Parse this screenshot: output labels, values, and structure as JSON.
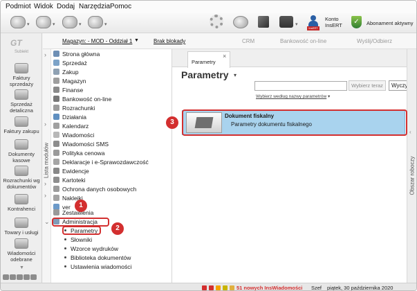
{
  "menu": [
    "Podmiot",
    "Widok",
    "Dodaj",
    "Narzędzia",
    "Pomoc"
  ],
  "toolbar": {
    "konto_line1": "Konto",
    "konto_line2": "InsERT",
    "abonament": "Abonament aktywny"
  },
  "subjekt": {
    "label": "Subiekt"
  },
  "left_nav": [
    {
      "label_1": "Faktury",
      "label_2": "sprzedaży"
    },
    {
      "label_1": "Sprzedaż",
      "label_2": "detaliczna"
    },
    {
      "label_1": "Faktury zakupu",
      "label_2": ""
    },
    {
      "label_1": "Dokumenty",
      "label_2": "kasowe"
    },
    {
      "label_1": "Rozrachunki wg",
      "label_2": "dokumentów"
    },
    {
      "label_1": "Kontrahenci",
      "label_2": ""
    },
    {
      "label_1": "Towary i usługi",
      "label_2": ""
    },
    {
      "label_1": "Wiadomości",
      "label_2": "odebrane"
    }
  ],
  "subbar": {
    "magazyn": "Magazyn: - MOD - Oddział 1",
    "blokady": "Brak blokady",
    "crm": "CRM",
    "bankowosc": "Bankowość on-line",
    "wyslij": "Wyślij/Odbierz"
  },
  "modules_label": "Lista modułów",
  "modules": [
    "Strona główna",
    "Sprzedaż",
    "Zakup",
    "Magazyn",
    "Finanse",
    "Bankowość on-line",
    "Rozrachunki",
    "Działania",
    "Kalendarz",
    "Wiadomości",
    "Wiadomości SMS",
    "Polityka cenowa",
    "Deklaracje i e-Sprawozdawczość",
    "Ewidencje",
    "Kartoteki",
    "Ochrona danych osobowych",
    "Naklejki",
    "ver",
    "Zestawienia",
    "Administracja"
  ],
  "admin_sub": [
    "Parametry",
    "Słowniki",
    "Wzorce wydruków",
    "Biblioteka dokumentów",
    "Ustawienia wiadomości"
  ],
  "main": {
    "tab": "Parametry",
    "title": "Parametry",
    "search_placeholder": "",
    "search_btn": "Wybierz teraz",
    "clear_btn": "Wyczyść",
    "filter": "Wybierz według nazwy parametrów",
    "card_title": "Dokument fiskalny",
    "card_desc": "Parametry dokumentu fiskalnego"
  },
  "right_panel": "Obszar roboczy",
  "status": {
    "news": "51 nowych InsWiadomości",
    "user": "Szef",
    "date": "piątek, 30 października 2020"
  },
  "callouts": [
    "1",
    "2",
    "3"
  ]
}
